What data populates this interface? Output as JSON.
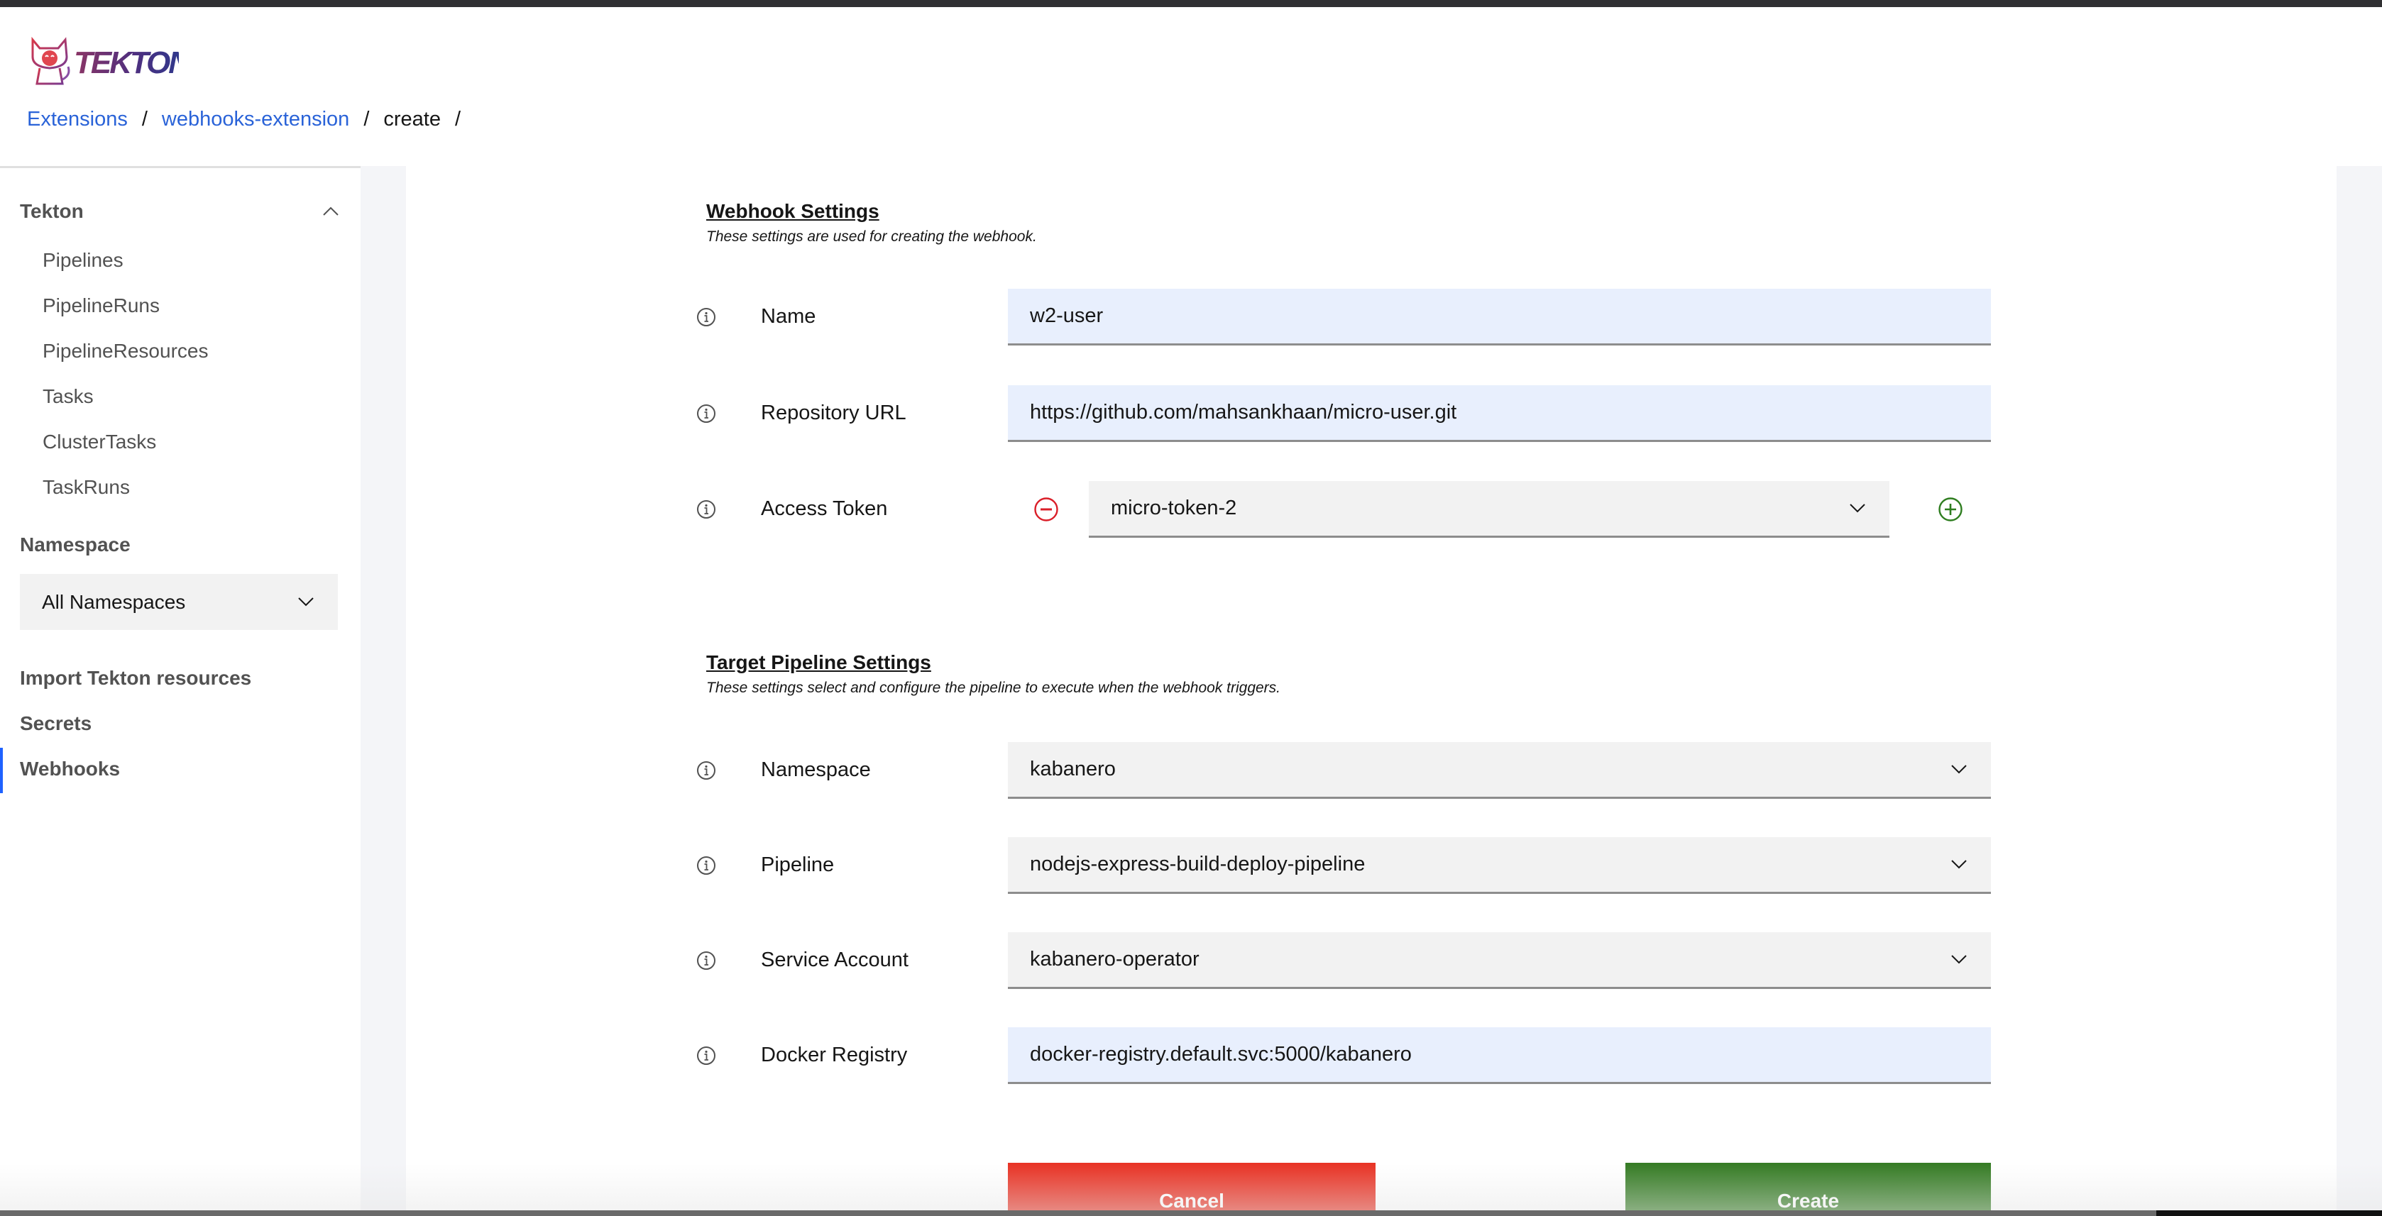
{
  "app": {
    "logo_text": "TEKTON",
    "logo_icon": "tekton-cat-logo"
  },
  "breadcrumb": {
    "items": [
      {
        "label": "Extensions",
        "link": true
      },
      {
        "label": "webhooks-extension",
        "link": true
      },
      {
        "label": "create",
        "link": false
      }
    ],
    "separator": "/"
  },
  "sidebar": {
    "section_title": "Tekton",
    "section_icon": "chevron-up-icon",
    "items": [
      {
        "label": "Pipelines"
      },
      {
        "label": "PipelineRuns"
      },
      {
        "label": "PipelineResources"
      },
      {
        "label": "Tasks"
      },
      {
        "label": "ClusterTasks"
      },
      {
        "label": "TaskRuns"
      }
    ],
    "namespace_label": "Namespace",
    "namespace_value": "All Namespaces",
    "links": [
      {
        "label": "Import Tekton resources",
        "active": false
      },
      {
        "label": "Secrets",
        "active": false
      },
      {
        "label": "Webhooks",
        "active": true
      }
    ],
    "active_color": "#1f62ff"
  },
  "webhook_settings": {
    "title": "Webhook Settings",
    "description": "These settings are used for creating the webhook.",
    "fields": {
      "name": {
        "label": "Name",
        "value": "w2-user"
      },
      "repository_url": {
        "label": "Repository URL",
        "value": "https://github.com/mahsankhaan/micro-user.git"
      },
      "access_token": {
        "label": "Access Token",
        "value": "micro-token-2",
        "remove_icon": "minus-circle-icon",
        "add_icon": "plus-circle-icon"
      }
    }
  },
  "target_pipeline_settings": {
    "title": "Target Pipeline Settings",
    "description": "These settings select and configure the pipeline to execute when the webhook triggers.",
    "fields": {
      "namespace": {
        "label": "Namespace",
        "value": "kabanero"
      },
      "pipeline": {
        "label": "Pipeline",
        "value": "nodejs-express-build-deploy-pipeline"
      },
      "service_account": {
        "label": "Service Account",
        "value": "kabanero-operator"
      },
      "docker_registry": {
        "label": "Docker Registry",
        "value": "docker-registry.default.svc:5000/kabanero"
      }
    }
  },
  "actions": {
    "cancel_label": "Cancel",
    "create_label": "Create",
    "cancel_color": "#e83325",
    "create_color": "#367c25"
  },
  "colors": {
    "link": "#2a63d8",
    "remove": "#da1e28",
    "add": "#24a148"
  }
}
